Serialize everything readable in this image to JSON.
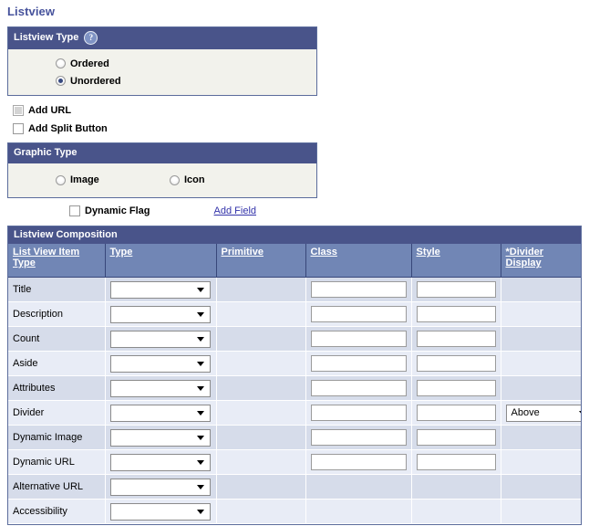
{
  "page": {
    "title": "Listview"
  },
  "listview_type": {
    "header": "Listview Type",
    "help_icon": "help-question-icon",
    "options": [
      {
        "label": "Ordered",
        "selected": false
      },
      {
        "label": "Unordered",
        "selected": true
      }
    ]
  },
  "checkboxes": [
    {
      "label": "Add URL",
      "checked": false,
      "disabled": true
    },
    {
      "label": "Add  Split Button",
      "checked": false,
      "disabled": false
    }
  ],
  "graphic_type": {
    "header": "Graphic Type",
    "options": [
      {
        "label": "Image",
        "selected": false
      },
      {
        "label": "Icon",
        "selected": false
      }
    ]
  },
  "dynamic_row": {
    "flag_label": "Dynamic Flag",
    "flag_checked": false,
    "add_field_link": "Add Field"
  },
  "composition": {
    "title": "Listview Composition",
    "columns": [
      "List View Item Type",
      "Type",
      "Primitive",
      "Class",
      "Style",
      "*Divider Display"
    ],
    "rows": [
      {
        "item": "Title",
        "type": "",
        "primitive": "",
        "has_type": true,
        "has_class": true,
        "has_style": true,
        "divider": null
      },
      {
        "item": "Description",
        "type": "",
        "primitive": "",
        "has_type": true,
        "has_class": true,
        "has_style": true,
        "divider": null
      },
      {
        "item": "Count",
        "type": "",
        "primitive": "",
        "has_type": true,
        "has_class": true,
        "has_style": true,
        "divider": null
      },
      {
        "item": "Aside",
        "type": "",
        "primitive": "",
        "has_type": true,
        "has_class": true,
        "has_style": true,
        "divider": null
      },
      {
        "item": "Attributes",
        "type": "",
        "primitive": "",
        "has_type": true,
        "has_class": true,
        "has_style": true,
        "divider": null
      },
      {
        "item": "Divider",
        "type": "",
        "primitive": "",
        "has_type": true,
        "has_class": true,
        "has_style": true,
        "divider": "Above"
      },
      {
        "item": "Dynamic Image",
        "type": "",
        "primitive": "",
        "has_type": true,
        "has_class": true,
        "has_style": true,
        "divider": null
      },
      {
        "item": "Dynamic URL",
        "type": "",
        "primitive": "",
        "has_type": true,
        "has_class": true,
        "has_style": true,
        "divider": null
      },
      {
        "item": "Alternative URL",
        "type": "",
        "primitive": "",
        "has_type": true,
        "has_class": false,
        "has_style": false,
        "divider": null
      },
      {
        "item": "Accessibility",
        "type": "",
        "primitive": "",
        "has_type": true,
        "has_class": false,
        "has_style": false,
        "divider": null
      }
    ]
  },
  "colors": {
    "header_bar": "#49548a",
    "column_header": "#7186b5",
    "row_odd": "#d6dcea",
    "row_even": "#e8ecf6",
    "title_text": "#46529c",
    "link": "#3333aa",
    "panel_body": "#f2f2ec"
  }
}
